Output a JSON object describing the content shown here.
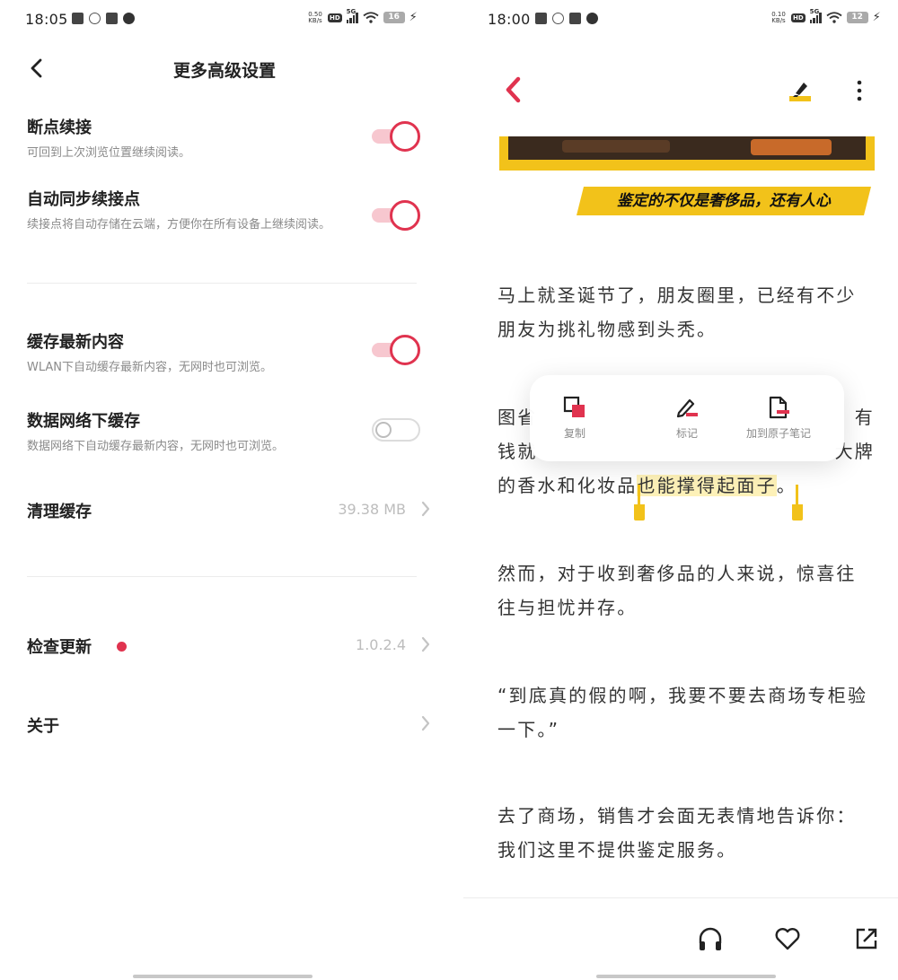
{
  "left": {
    "status": {
      "time": "18:05",
      "net_speed_top": "0.50",
      "net_speed_unit": "KB/s",
      "hd": "HD",
      "signal": "5G",
      "battery": "16"
    },
    "header": {
      "title": "更多高级设置"
    },
    "settings": [
      {
        "title": "断点续接",
        "desc": "可回到上次浏览位置继续阅读。",
        "enabled": true
      },
      {
        "title": "自动同步续接点",
        "desc": "续接点将自动存储在云端，方便你在所有设备上继续阅读。",
        "enabled": true
      },
      {
        "title": "缓存最新内容",
        "desc": "WLAN下自动缓存最新内容，无网时也可浏览。",
        "enabled": true
      },
      {
        "title": "数据网络下缓存",
        "desc": "数据网络下自动缓存最新内容，无网时也可浏览。",
        "enabled": false
      }
    ],
    "clear_cache": {
      "label": "清理缓存",
      "value": "39.38  MB"
    },
    "check_update": {
      "label": "检查更新",
      "value": "1.0.2.4"
    },
    "about": {
      "label": "关于"
    }
  },
  "right": {
    "status": {
      "time": "18:00",
      "net_speed_top": "0.10",
      "net_speed_unit": "KB/s",
      "hd": "HD",
      "signal": "5G",
      "battery": "12"
    },
    "banner_text": "鉴定的不仅是奢侈品，还有人心",
    "paragraphs": {
      "p1": "马上就圣诞节了，朋友圈里，已经有不少朋友为挑礼物感到头秃。",
      "p2_line1_start": "图省",
      "p2_line1_end": "有",
      "p2_line2_start": "钱就",
      "p2_line2_end": "大牌",
      "p2_line3_pre": "的香水和化妆品",
      "p2_line3_highlight": "也能撑得起面子",
      "p2_line3_post": "。",
      "p3": "然而，对于收到奢侈品的人来说，惊喜往往与担忧并存。",
      "p4": "“到底真的假的啊，我要不要去商场专柜验一下。”",
      "p5": "去了商场，销售才会面无表情地告诉你：我们这里不提供鉴定服务。"
    },
    "popup": {
      "copy": "复制",
      "mark": "标记",
      "add_note": "加到原子笔记"
    },
    "colors": {
      "accent": "#e0334f",
      "highlight": "#f2c21a"
    }
  }
}
